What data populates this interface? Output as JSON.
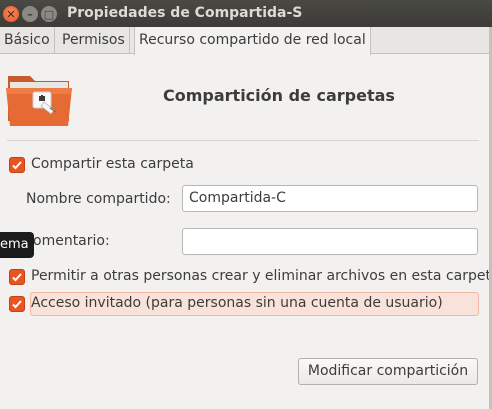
{
  "window": {
    "title": "Propiedades de Compartida-S"
  },
  "tabs": [
    {
      "label": "Básico",
      "active": false
    },
    {
      "label": "Permisos",
      "active": false
    },
    {
      "label": "Recurso compartido de red local",
      "active": true
    }
  ],
  "header": {
    "title": "Compartición de carpetas",
    "icon": "shared-folder-icon"
  },
  "form": {
    "share_checkbox": {
      "label": "Compartir esta carpeta",
      "checked": true
    },
    "share_name": {
      "label": "Nombre compartido:",
      "value": "Compartida-C"
    },
    "comment": {
      "label": "omentario:",
      "value": ""
    },
    "allow_others": {
      "label": "Permitir a otras personas crear y eliminar archivos en esta carpeta",
      "checked": true
    },
    "guest_access": {
      "label": "Acceso invitado (para personas sin una cuenta de usuario)",
      "checked": true
    }
  },
  "tooltip": {
    "text": "ema"
  },
  "actions": {
    "modify_label": "Modificar compartición"
  },
  "colors": {
    "accent": "#e95420",
    "titlebar": "#3c3b37",
    "background": "#f2f1f0"
  }
}
